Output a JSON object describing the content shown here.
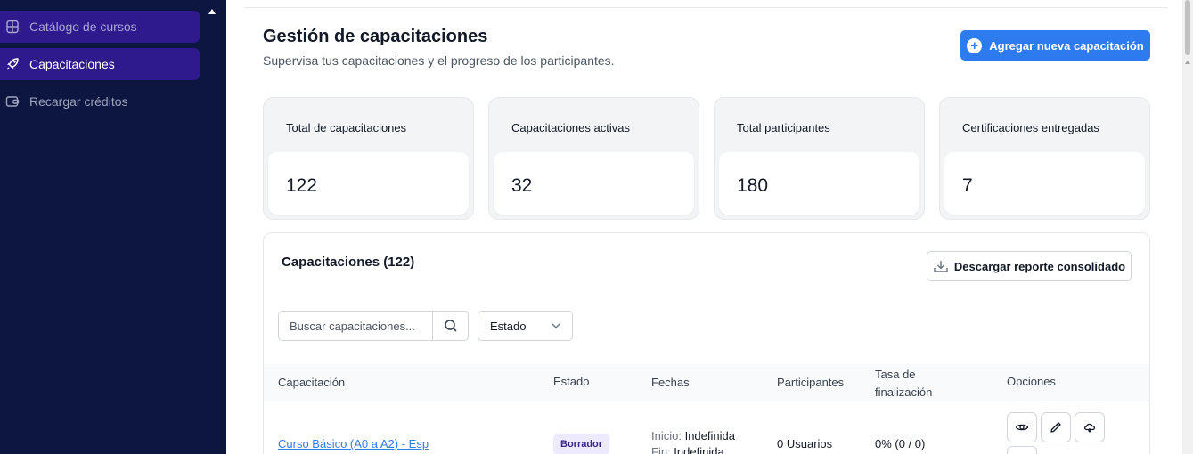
{
  "sidebar": {
    "items": [
      {
        "label": "Catálogo de cursos",
        "icon": "catalog-icon"
      },
      {
        "label": "Capacitaciones",
        "icon": "rocket-icon"
      },
      {
        "label": "Recargar créditos",
        "icon": "wallet-icon"
      }
    ]
  },
  "header": {
    "title": "Gestión de capacitaciones",
    "subtitle": "Supervisa tus capacitaciones y el progreso de los participantes.",
    "add_button": "Agregar nueva capacitación"
  },
  "stats": [
    {
      "label": "Total de capacitaciones",
      "value": "122"
    },
    {
      "label": "Capacitaciones activas",
      "value": "32"
    },
    {
      "label": "Total participantes",
      "value": "180"
    },
    {
      "label": "Certificaciones entregadas",
      "value": "7"
    }
  ],
  "table": {
    "title": "Capacitaciones (122)",
    "download_button": "Descargar reporte consolidado",
    "search_placeholder": "Buscar capacitaciones...",
    "status_filter": "Estado",
    "columns": [
      "Capacitación",
      "Estado",
      "Fechas",
      "Participantes",
      "Tasa de",
      "finalización",
      "Opciones"
    ],
    "rows": [
      {
        "name": "Curso Básico (A0 a A2) - Esp",
        "status": "Borrador",
        "start_label": "Inicio:",
        "start_value": "Indefinida",
        "end_label": "Fin:",
        "end_value": "Indefinida",
        "participants": "0 Usuarios",
        "completion": "0% (0 / 0)"
      }
    ]
  },
  "colors": {
    "sidebar_bg": "#0d1640",
    "sidebar_active": "#2e1a8c",
    "primary": "#2e7bf0",
    "badge_bg": "#ede9fe"
  }
}
